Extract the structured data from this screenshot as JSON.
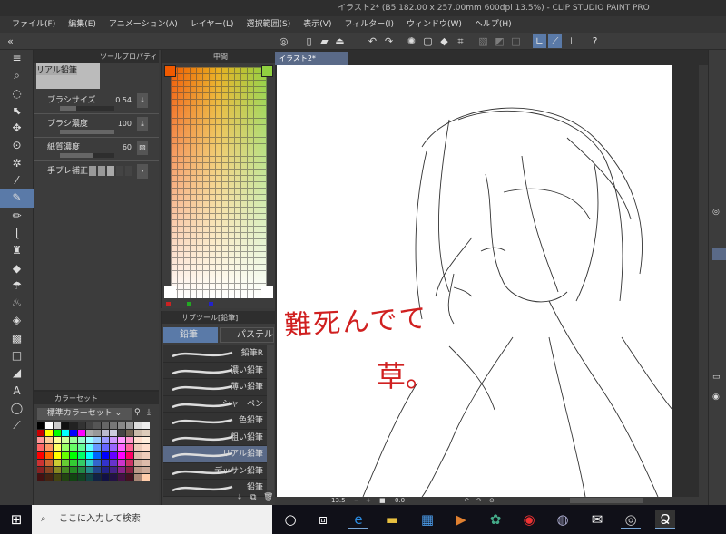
{
  "title": "イラスト2* (B5 182.00 x 257.00mm 600dpi 13.5%) - CLIP STUDIO PAINT PRO",
  "menu": [
    "ファイル(F)",
    "編集(E)",
    "アニメーション(A)",
    "レイヤー(L)",
    "選択範囲(S)",
    "表示(V)",
    "フィルター(I)",
    "ウィンドウ(W)",
    "ヘルプ(H)"
  ],
  "tool_property": {
    "tab": "ツールプロパティ",
    "preset": "リアル鉛筆",
    "brush_size": {
      "label": "ブラシサイズ",
      "value": "0.54"
    },
    "brush_density": {
      "label": "ブラシ濃度",
      "value": "100"
    },
    "paper_density": {
      "label": "紙質濃度",
      "value": "60"
    },
    "stabilization": {
      "label": "手ブレ補正",
      "level": 3,
      "max": 6
    }
  },
  "color_panel": {
    "tab": "中間",
    "main_color": "#f05a00",
    "sub_color": "#90d040"
  },
  "subtool": {
    "tab": "サブツール[鉛筆]",
    "groups": [
      "鉛筆",
      "パステル"
    ],
    "active_group": "鉛筆",
    "brushes": [
      "鉛筆R",
      "濃い鉛筆",
      "薄い鉛筆",
      "シャーペン",
      "色鉛筆",
      "粗い鉛筆",
      "リアル鉛筆",
      "デッサン鉛筆",
      "鉛筆"
    ],
    "selected": "リアル鉛筆"
  },
  "color_set": {
    "tab": "カラーセット",
    "selected_set": "標準カラーセット"
  },
  "document": {
    "tab": "イラスト2*",
    "handwriting": [
      "難死んでて",
      "草。"
    ],
    "ink_color": "#d02020"
  },
  "status": {
    "zoom": "13.5",
    "rotation": "0.0"
  },
  "taskbar": {
    "search_placeholder": "ここに入力して検索"
  }
}
